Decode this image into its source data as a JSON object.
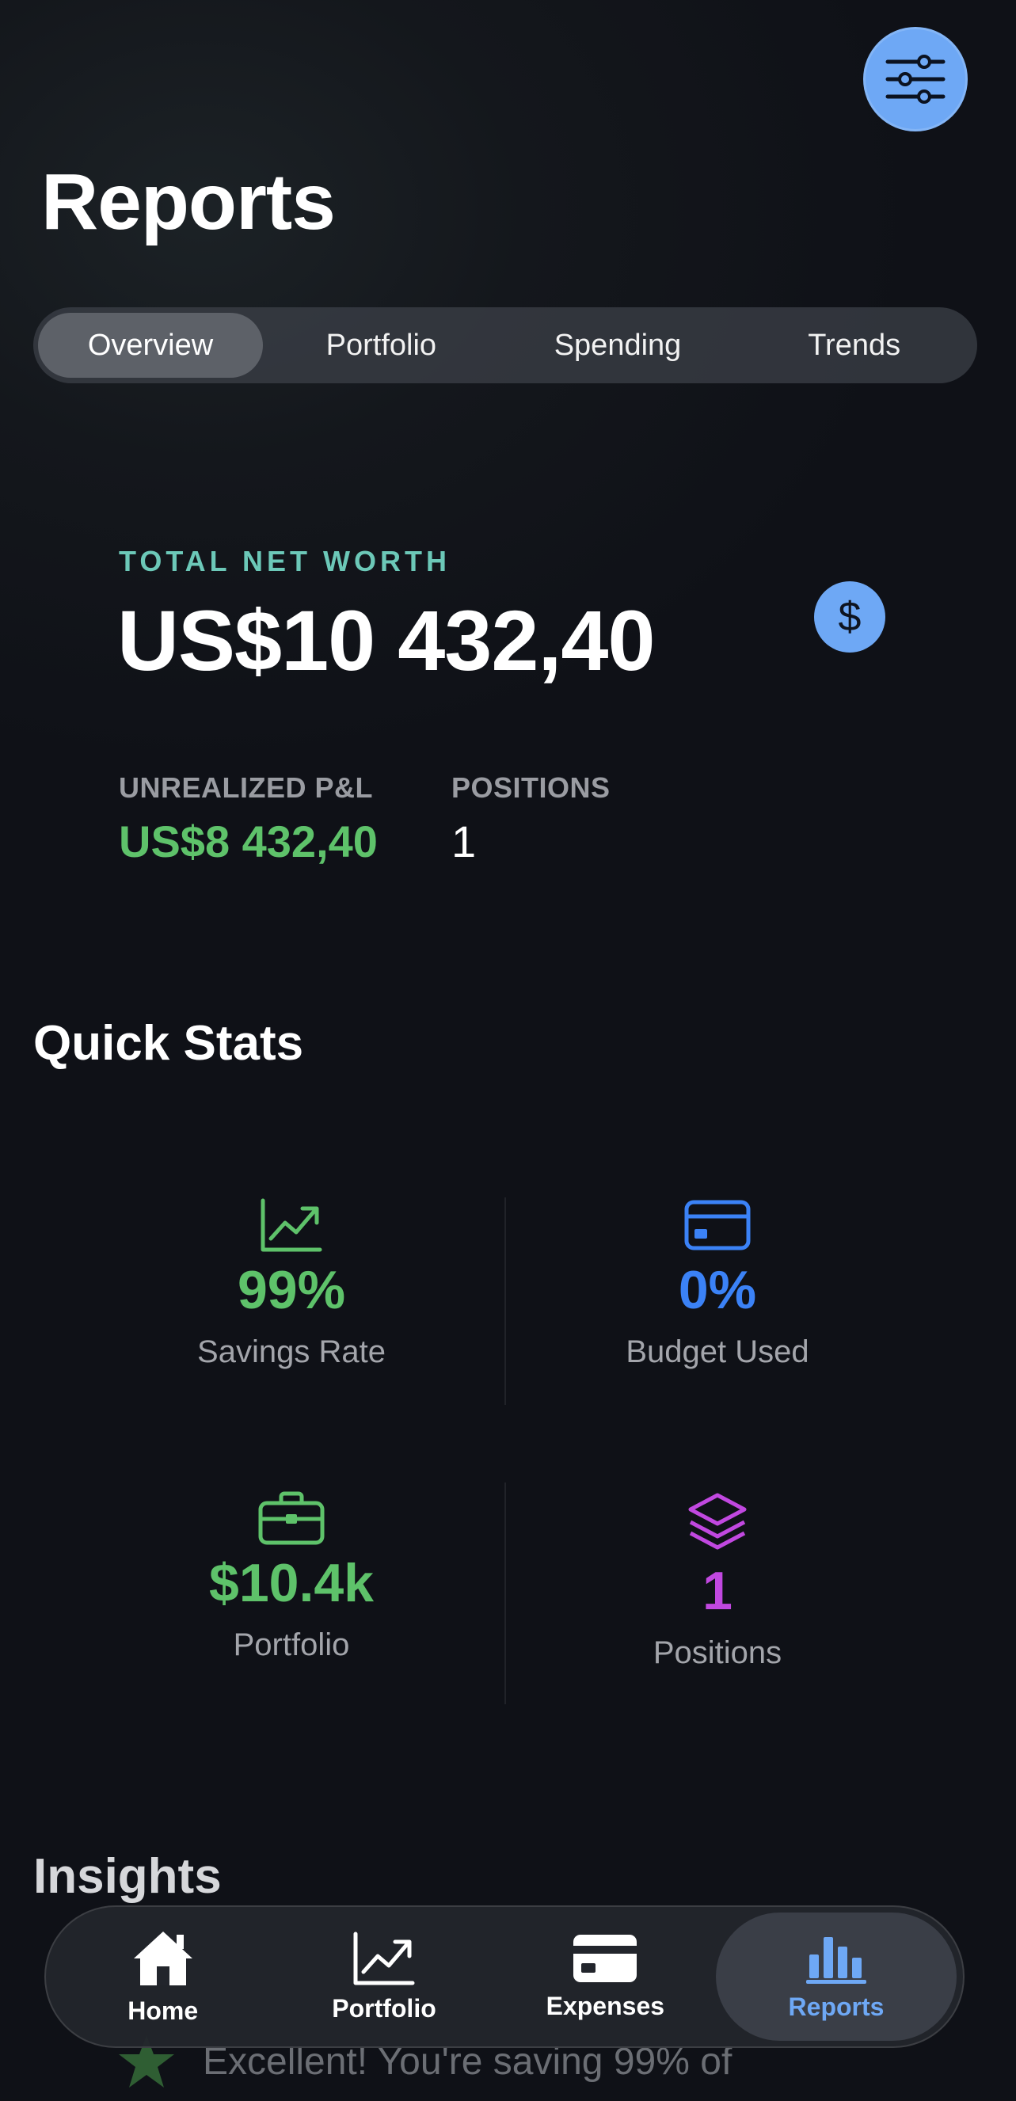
{
  "header": {
    "title": "Reports",
    "filter_icon": "sliders-icon"
  },
  "tabs": [
    {
      "label": "Overview",
      "active": true
    },
    {
      "label": "Portfolio",
      "active": false
    },
    {
      "label": "Spending",
      "active": false
    },
    {
      "label": "Trends",
      "active": false
    }
  ],
  "net_worth": {
    "label": "TOTAL NET WORTH",
    "value": "US$10 432,40",
    "badge_icon": "dollar-icon",
    "badge_glyph": "$",
    "unrealized_label": "UNREALIZED P&L",
    "unrealized_value": "US$8 432,40",
    "positions_label": "POSITIONS",
    "positions_value": "1"
  },
  "quick_stats": {
    "title": "Quick Stats",
    "items": [
      {
        "value": "99%",
        "label": "Savings Rate",
        "icon": "chart-line-icon",
        "color": "#5ec26a"
      },
      {
        "value": "0%",
        "label": "Budget Used",
        "icon": "credit-card-icon",
        "color": "#3b82f6"
      },
      {
        "value": "$10.4k",
        "label": "Portfolio",
        "icon": "briefcase-icon",
        "color": "#5ec26a"
      },
      {
        "value": "1",
        "label": "Positions",
        "icon": "layers-icon",
        "color": "#c148e0"
      }
    ]
  },
  "insights": {
    "title": "Insights",
    "first_item": "Excellent! You're saving 99% of",
    "first_item_icon": "star-icon"
  },
  "bottom_nav": [
    {
      "label": "Home",
      "icon": "home-icon",
      "active": false
    },
    {
      "label": "Portfolio",
      "icon": "chart-line-icon",
      "active": false
    },
    {
      "label": "Expenses",
      "icon": "credit-card-icon",
      "active": false
    },
    {
      "label": "Reports",
      "icon": "bar-chart-icon",
      "active": true
    }
  ],
  "colors": {
    "accent_blue": "#6ea8f5",
    "positive_green": "#5ec26a",
    "teal_label": "#6cc8b8",
    "purple": "#c148e0"
  }
}
